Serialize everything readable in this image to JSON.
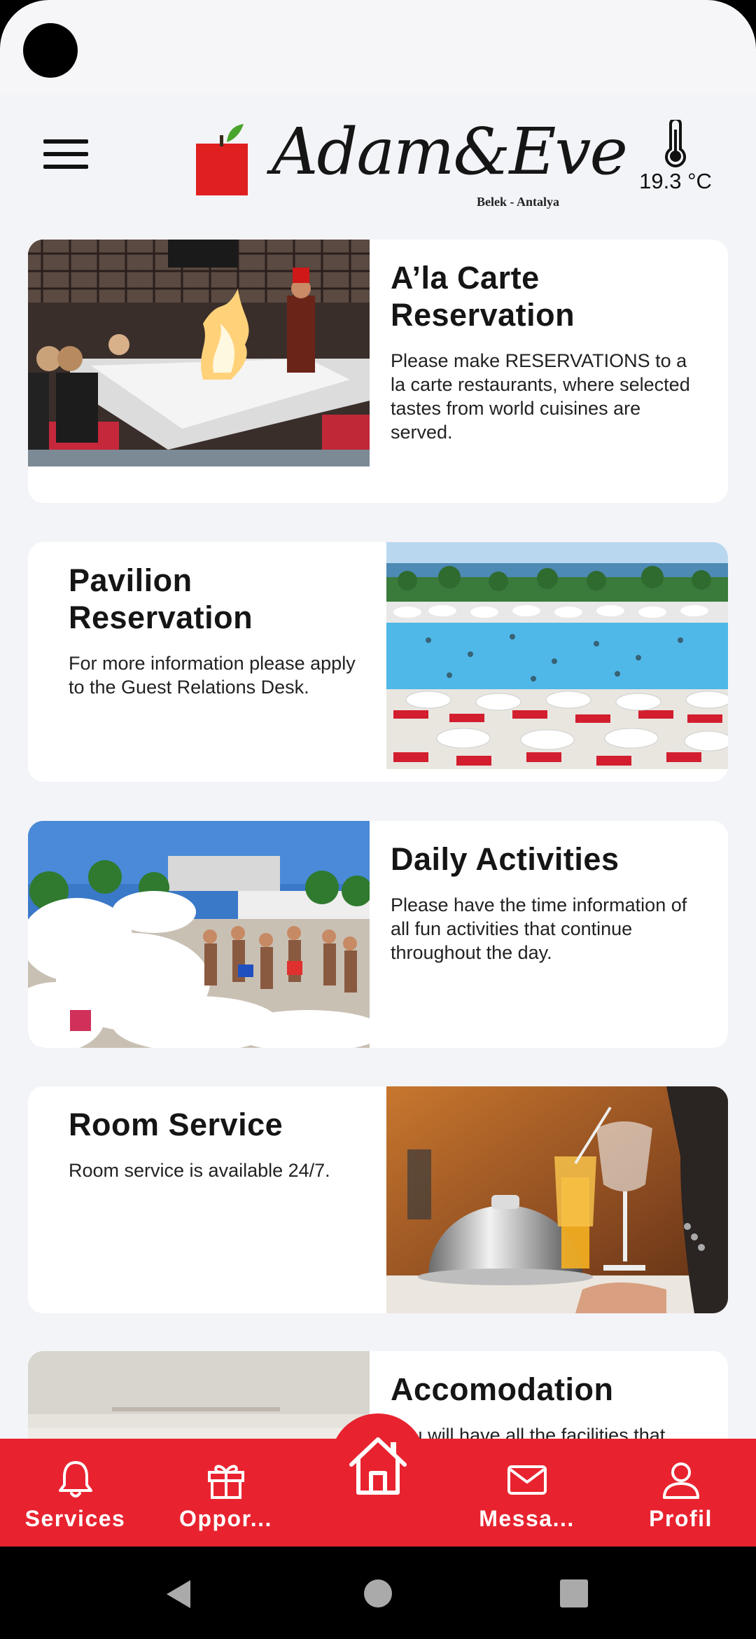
{
  "header": {
    "logo_text": "Adam&Eve",
    "logo_subtitle": "Belek - Antalya",
    "temperature": "19.3 °C",
    "icons": {
      "menu": "hamburger-menu-icon",
      "weather": "thermometer-icon"
    }
  },
  "cards": [
    {
      "title": "A’la Carte Reservation",
      "description": "Please make RESERVATIONS to a la carte restaurants, where selected tastes from world cuisines are served.",
      "image": "teppanyaki-restaurant-photo"
    },
    {
      "title": "Pavilion Reservation",
      "description": "For more information please apply to the Guest Relations Desk.",
      "image": "pool-pavilion-photo"
    },
    {
      "title": "Daily Activities",
      "description": "Please have the time information of all fun activities that continue throughout the day.",
      "image": "foam-party-photo"
    },
    {
      "title": "Room Service",
      "description": "Room service is available 24/7.",
      "image": "room-service-cloche-photo"
    },
    {
      "title": "Accomodation",
      "description": "You will have all the facilities that",
      "image": "room-interior-photo"
    }
  ],
  "bottom_nav": {
    "items": [
      {
        "label": "Services",
        "icon": "bell-icon"
      },
      {
        "label": "Oppor...",
        "icon": "gift-icon"
      },
      {
        "label": "",
        "icon": "home-icon"
      },
      {
        "label": "Messa...",
        "icon": "mail-icon"
      },
      {
        "label": "Profil",
        "icon": "user-icon"
      }
    ]
  },
  "colors": {
    "brand_red": "#e8232f",
    "background": "#f3f4f8",
    "card": "#ffffff",
    "text": "#151515"
  }
}
